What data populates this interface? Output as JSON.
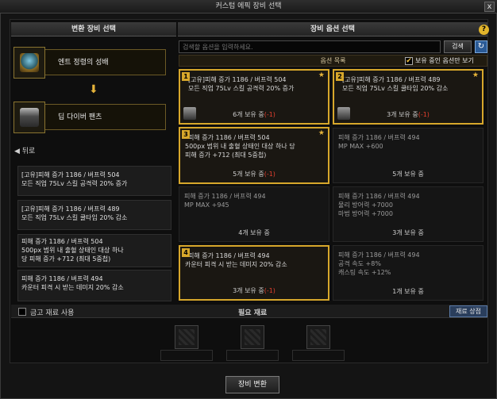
{
  "window": {
    "title": "커스텀 에픽 장비 선택",
    "close": "x"
  },
  "left": {
    "header": "변환 장비 선택",
    "source_item": "엔트 정령의 성배",
    "target_item": "딥 다이버 팬츠",
    "arrow": "⬇",
    "back_label": "◀ 뒤로",
    "options": [
      {
        "l1": "[고유]피해 증가 1186 / 버프력 504",
        "l2": "모든 직업 75Lv 스킬 공격력 20% 증가",
        "l3": ""
      },
      {
        "l1": "[고유]피해 증가 1186 / 버프력 489",
        "l2": "모든 직업 75Lv 스킬 쿨타임 20% 감소",
        "l3": ""
      },
      {
        "l1": "피해 증가 1186 / 버프력 504",
        "l2": "500px 범위 내 출혈 상태인 대상 하나",
        "l3": "당 피해 증가 +712 (최대 5중첩)"
      },
      {
        "l1": "피해 증가 1186 / 버프력 494",
        "l2": "카운터 피격 시 받는 데미지 20% 감소",
        "l3": ""
      }
    ]
  },
  "right": {
    "header": "장비 옵션 선택",
    "help": "?",
    "search_placeholder": "검색할 옵션을 입력하세요.",
    "search_button": "검색",
    "refresh": "↻",
    "list_title": "옵션 목록",
    "owned_only_label": "보유 중인 옵션만 보기",
    "owned_only_checked": "✔",
    "cards": [
      {
        "num": "1",
        "star": "★",
        "l1": "[고유]피해 증가 1186 / 버프력 504",
        "l2": "모든 직업 75Lv 스킬 공격력 20% 증가",
        "l3": "",
        "count": "6개 보유 중",
        "neg": "(-1)"
      },
      {
        "num": "2",
        "star": "★",
        "l1": "[고유]피해 증가 1186 / 버프력 489",
        "l2": "모든 직업 75Lv 스킬 쿨타임 20% 감소",
        "l3": "",
        "count": "3개 보유 중",
        "neg": "(-1)"
      },
      {
        "num": "3",
        "star": "★",
        "l1": "피해 증가 1186 / 버프력 504",
        "l2": "500px 범위 내 출혈 상태인 대상 하나 당",
        "l3": "피해 증가 +712 (최대 5중첩)",
        "count": "5개 보유 중",
        "neg": "(-1)"
      },
      {
        "num": "",
        "star": "",
        "l1": "피해 증가 1186 / 버프력 494",
        "l2": "MP MAX +600",
        "l3": "",
        "count": "5개 보유 중",
        "neg": ""
      },
      {
        "num": "",
        "star": "",
        "l1": "피해 증가 1186 / 버프력 494",
        "l2": "MP MAX +945",
        "l3": "",
        "count": "4개 보유 중",
        "neg": ""
      },
      {
        "num": "",
        "star": "",
        "l1": "피해 증가 1186 / 버프력 494",
        "l2": "물리 방어력 +7000",
        "l3": "마법 방어력 +7000",
        "count": "3개 보유 중",
        "neg": ""
      },
      {
        "num": "4",
        "star": "",
        "l1": "피해 증가 1186 / 버프력 494",
        "l2": "카운터 피격 시 받는 데미지 20% 감소",
        "l3": "",
        "count": "3개 보유 중",
        "neg": "(-1)"
      },
      {
        "num": "",
        "star": "",
        "l1": "피해 증가 1186 / 버프력 494",
        "l2": "공격 속도 +8%",
        "l3": "캐스팅 속도 +12%",
        "count": "1개 보유 중",
        "neg": ""
      }
    ]
  },
  "materials": {
    "gold_label": "금고 재료 사용",
    "required_label": "필요 재료",
    "detail_button": "재료 상점"
  },
  "convert_button": "장비 변환"
}
